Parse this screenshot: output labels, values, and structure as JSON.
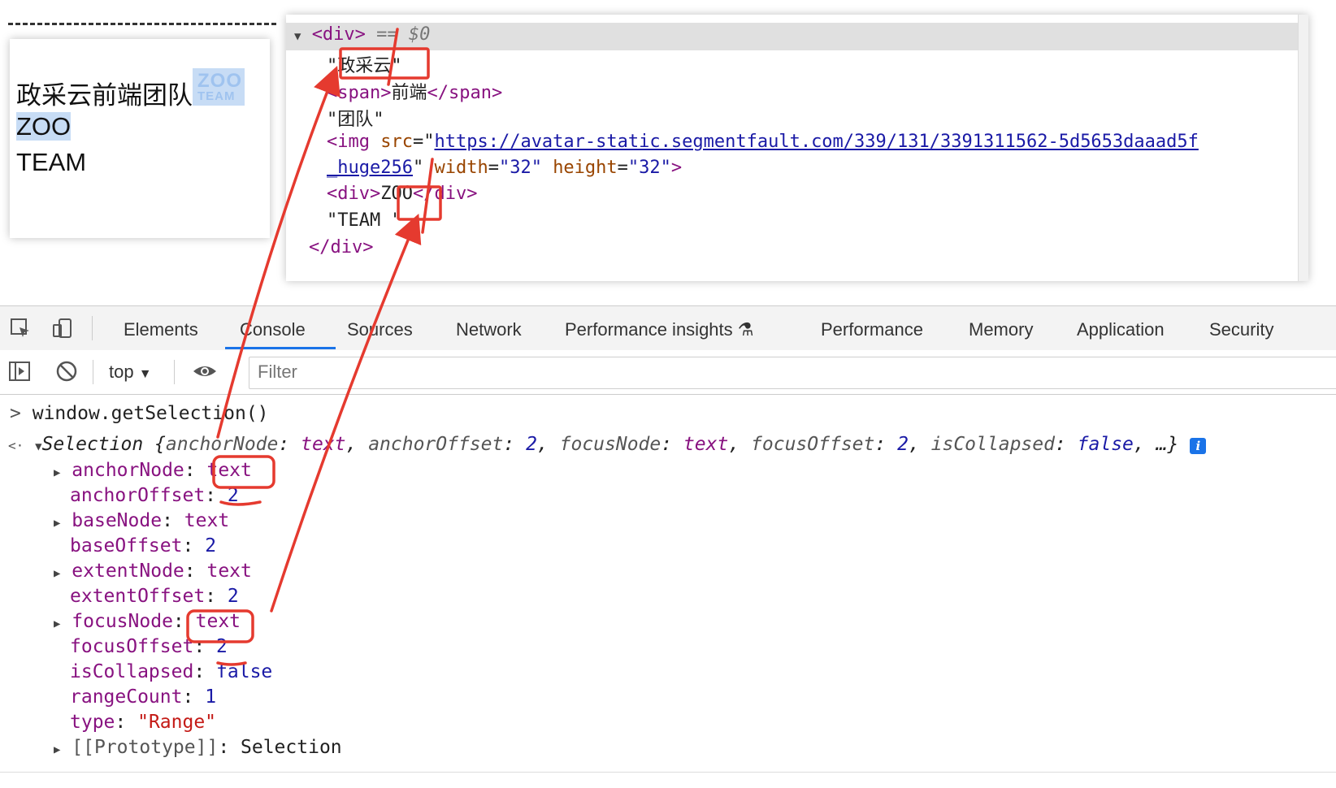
{
  "preview": {
    "line1_text": "政采云前端团队",
    "logo_top": "ZOO",
    "logo_bottom": "TEAM",
    "line2_text": "ZOO",
    "line3_text": "TEAM"
  },
  "elements_panel": {
    "div_open": "<div>",
    "eq_ref": "== $0",
    "text1": "\"政采云\"",
    "span_open": "<span>",
    "span_text": "前端",
    "span_close": "</span>",
    "text2": "\"团队\"",
    "img_open": "<img",
    "src_attr": "src",
    "src_url_line1": "https://avatar-static.segmentfault.com/339/131/3391311562-5d5653daaad5f",
    "src_url_line2": "_huge256",
    "width_attr": "width",
    "width_val": "\"32\"",
    "height_attr": "height",
    "height_val": "\"32\"",
    "div2_open": "<div>",
    "div2_text": "ZOO",
    "div2_close": "</div>",
    "text3": "\"TEAM \"",
    "div_close": "</div>"
  },
  "devtools_tabs": [
    {
      "label": "Elements"
    },
    {
      "label": "Console"
    },
    {
      "label": "Sources"
    },
    {
      "label": "Network"
    },
    {
      "label": "Performance insights"
    },
    {
      "label": "Performance"
    },
    {
      "label": "Memory"
    },
    {
      "label": "Application"
    },
    {
      "label": "Security"
    }
  ],
  "active_tab": "Console",
  "toolbar": {
    "context": "top",
    "filter_placeholder": "Filter"
  },
  "console": {
    "input_cmd": "window.getSelection()",
    "summary_type": "Selection",
    "summary_anchorNode_key": "anchorNode",
    "summary_anchorNode_val": "text",
    "summary_anchorOffset_key": "anchorOffset",
    "summary_anchorOffset_val": "2",
    "summary_focusNode_key": "focusNode",
    "summary_focusNode_val": "text",
    "summary_focusOffset_key": "focusOffset",
    "summary_focusOffset_val": "2",
    "summary_isCollapsed_key": "isCollapsed",
    "summary_isCollapsed_val": "false",
    "summary_ellipsis": "…}",
    "props": [
      {
        "key": "anchorNode",
        "value": "text"
      },
      {
        "key": "anchorOffset",
        "value": "2"
      },
      {
        "key": "baseNode",
        "value": "text"
      },
      {
        "key": "baseOffset",
        "value": "2"
      },
      {
        "key": "extentNode",
        "value": "text"
      },
      {
        "key": "extentOffset",
        "value": "2"
      },
      {
        "key": "focusNode",
        "value": "text"
      },
      {
        "key": "focusOffset",
        "value": "2"
      },
      {
        "key": "isCollapsed",
        "value": "false"
      },
      {
        "key": "rangeCount",
        "value": "1"
      },
      {
        "key": "type",
        "value": "\"Range\""
      },
      {
        "key": "[[Prototype]]",
        "value": "Selection"
      }
    ]
  },
  "colors": {
    "annotation_red": "#e53a2f",
    "selection_blue": "#c7dcf5",
    "tab_active": "#1a73e8",
    "key_purple": "#881280",
    "num_blue": "#1a1aa6",
    "string_red": "#c41a16"
  }
}
